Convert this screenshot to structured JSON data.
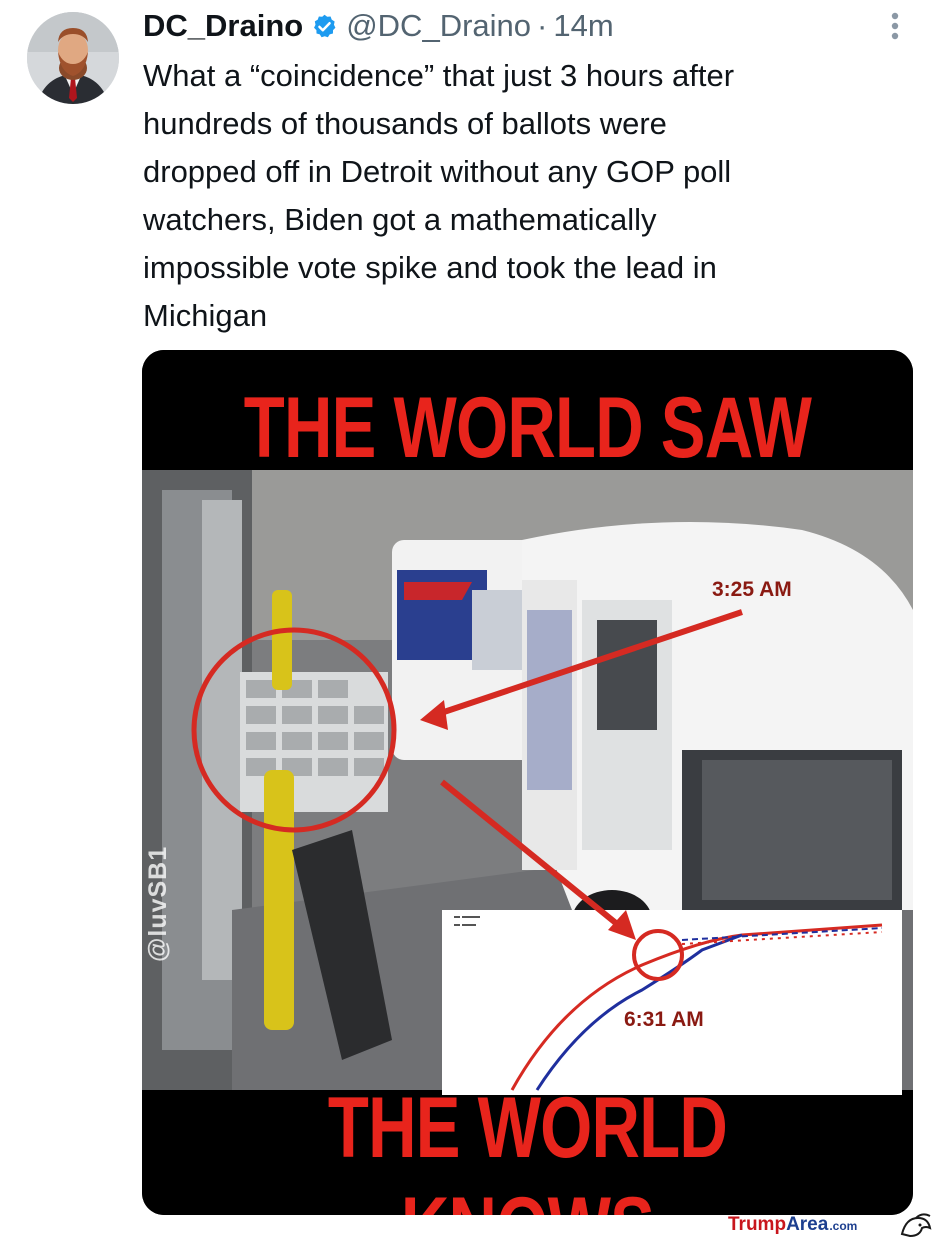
{
  "tweet": {
    "display_name": "DC_Draino",
    "handle": "@DC_Draino",
    "separator": "·",
    "time": "14m",
    "text": "What a “coincidence” that just 3 hours after\nhundreds of thousands of ballots were\ndropped off in Detroit without any GOP poll\nwatchers, Biden got a mathematically\nimpossible vote spike and took the lead in\nMichigan",
    "verified_icon": "verified-badge-icon",
    "more_icon": "more-vertical-icon"
  },
  "media": {
    "top_text": "THE WORLD SAW",
    "bottom_text": "THE WORLD KNOWS",
    "time_top": "3:25 AM",
    "time_bottom": "6:31 AM",
    "watermark": "@luvSB1"
  },
  "footer": {
    "site_trump": "Trump",
    "site_area": "Area",
    "site_com": ".com"
  },
  "colors": {
    "verified": "#1d9bf0",
    "meme_red": "#e8241c",
    "text": "#0f1419",
    "muted": "#536471"
  }
}
